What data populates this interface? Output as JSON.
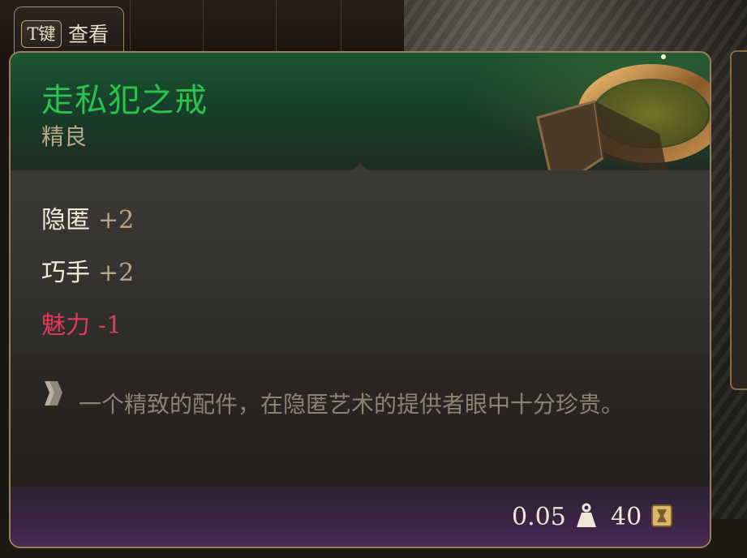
{
  "keybind": {
    "key": "T键",
    "label": "查看"
  },
  "item": {
    "name": "走私犯之戒",
    "rarity": "精良",
    "stats": [
      {
        "name": "隐匿",
        "value": "+2",
        "negative": false
      },
      {
        "name": "巧手",
        "value": "+2",
        "negative": false
      },
      {
        "name": "魅力",
        "value": "-1",
        "negative": true
      }
    ],
    "description": "一个精致的配件，在隐匿艺术的提供者眼中十分珍贵。",
    "weight": "0.05",
    "price": "40"
  },
  "colors": {
    "rarity_uncommon": "#2bc24f",
    "negative_stat": "#e03a5a",
    "frame_gold": "#9c7f59"
  },
  "icons": {
    "weight": "weight-icon",
    "price": "gold-coin-icon",
    "description": "scroll-bullet-icon",
    "item": "ring-icon"
  }
}
